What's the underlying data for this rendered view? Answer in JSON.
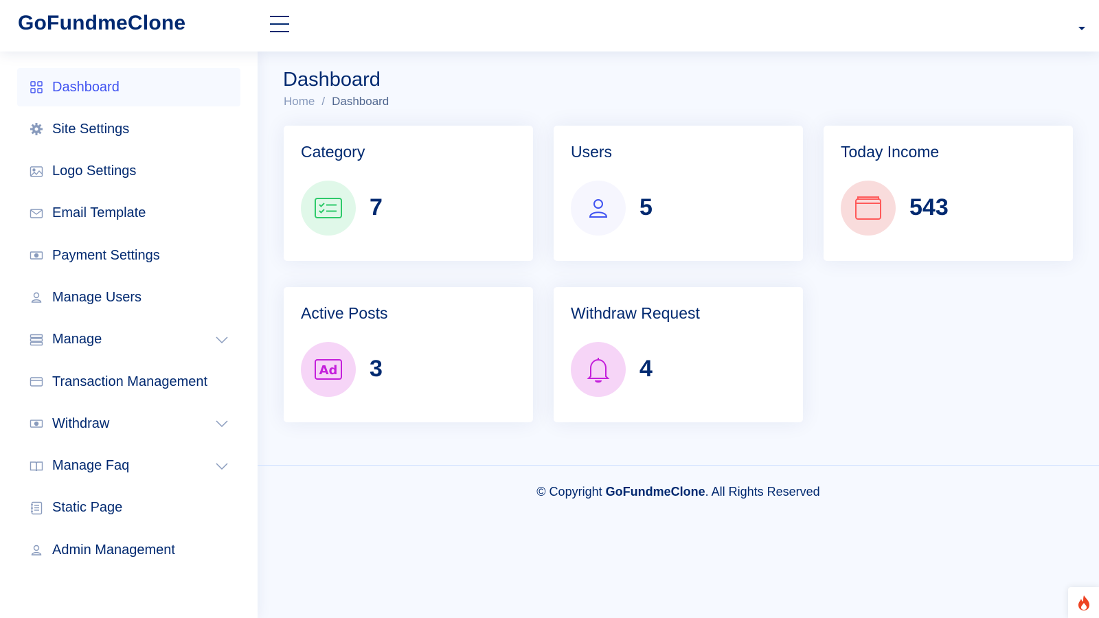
{
  "header": {
    "logo": "GoFundmeClone"
  },
  "sidebar": {
    "items": [
      {
        "label": "Dashboard",
        "icon": "grid-icon",
        "active": true
      },
      {
        "label": "Site Settings",
        "icon": "gear-icon"
      },
      {
        "label": "Logo Settings",
        "icon": "image-icon"
      },
      {
        "label": "Email Template",
        "icon": "envelope-icon"
      },
      {
        "label": "Payment Settings",
        "icon": "cash-icon"
      },
      {
        "label": "Manage Users",
        "icon": "person-icon"
      },
      {
        "label": "Manage",
        "icon": "layers-icon",
        "expandable": true
      },
      {
        "label": "Transaction Management",
        "icon": "credit-card-icon"
      },
      {
        "label": "Withdraw",
        "icon": "cash-icon",
        "expandable": true
      },
      {
        "label": "Manage Faq",
        "icon": "book-icon",
        "expandable": true
      },
      {
        "label": "Static Page",
        "icon": "journal-icon"
      },
      {
        "label": "Admin Management",
        "icon": "person-icon"
      }
    ]
  },
  "main": {
    "title": "Dashboard",
    "breadcrumb": {
      "home": "Home",
      "separator": "/",
      "current": "Dashboard"
    },
    "cards": [
      {
        "title": "Category",
        "value": "7",
        "icon": "card-checklist-icon",
        "color": "#2eca6a",
        "bg": "#e0f8e9"
      },
      {
        "title": "Users",
        "value": "5",
        "icon": "person-icon",
        "color": "#4154f1",
        "bg": "#f6f6fe"
      },
      {
        "title": "Today Income",
        "value": "543",
        "icon": "wallet-icon",
        "color": "#ff5a5a",
        "bg": "#f9dcdc"
      },
      {
        "title": "Active Posts",
        "value": "3",
        "icon": "ad-icon",
        "color": "#c41fdb",
        "bg": "#f6d5f7"
      },
      {
        "title": "Withdraw Request",
        "value": "4",
        "icon": "bell-icon",
        "color": "#c41fdb",
        "bg": "#f6d5f7"
      }
    ]
  },
  "footer": {
    "prefix": "© Copyright ",
    "brand": "GoFundmeClone",
    "suffix": ". All Rights Reserved"
  }
}
